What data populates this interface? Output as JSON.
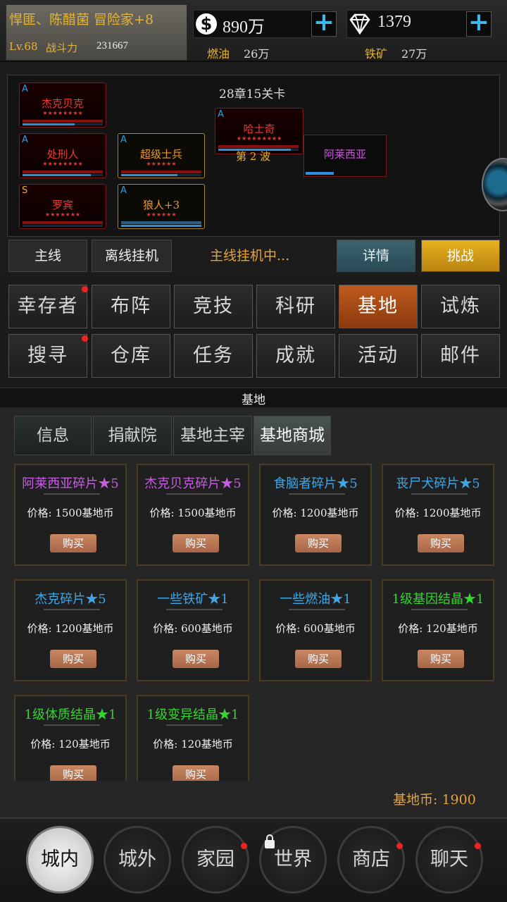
{
  "player": {
    "name": "悍匪、陈醋菌 冒险家+8",
    "level": "Lv.68",
    "power_label": "战斗力",
    "power_value": "231667"
  },
  "resources": {
    "money": "890万",
    "diamonds": "1379",
    "fuel_label": "燃油",
    "fuel_value": "26万",
    "ore_label": "铁矿",
    "ore_value": "27万",
    "money_icon": "dollar-coin-icon",
    "diamond_icon": "diamond-icon",
    "plus_symbol": "+"
  },
  "battle": {
    "stage": "28章15关卡",
    "wave": "第 2 波",
    "allies": [
      {
        "grade": "A",
        "name": "杰克贝克",
        "stars": "★★★★★★★★"
      },
      {
        "grade": "A",
        "name": "处刑人",
        "stars": "★★★★★★★★"
      },
      {
        "grade": "A",
        "name": "超级士兵",
        "stars": "★★★★★★"
      },
      {
        "grade": "S",
        "name": "罗宾",
        "stars": "★★★★★★★"
      },
      {
        "grade": "A",
        "name": "狼人+3",
        "stars": "★★★★★★"
      }
    ],
    "enemy": {
      "grade": "A",
      "name": "哈士奇",
      "stars": "★★★★★★★★★"
    },
    "boss": {
      "name": "阿莱西亚"
    }
  },
  "modes": {
    "main": "主线",
    "offline": "离线挂机",
    "status": "主线挂机中...",
    "detail": "详情",
    "challenge": "挑战"
  },
  "menu": [
    "幸存者",
    "布阵",
    "竞技",
    "科研",
    "基地",
    "试炼",
    "搜寻",
    "仓库",
    "任务",
    "成就",
    "活动",
    "邮件"
  ],
  "section_title": "基地",
  "sub_tabs": [
    "信息",
    "捐献院",
    "基地主宰",
    "基地商城"
  ],
  "shop": {
    "buy_label": "购买",
    "items": [
      {
        "name": "阿莱西亚碎片★5",
        "price": "价格: 1500基地币",
        "color": "#c75de2"
      },
      {
        "name": "杰克贝克碎片★5",
        "price": "价格: 1500基地币",
        "color": "#c75de2"
      },
      {
        "name": "食脑者碎片★5",
        "price": "价格: 1200基地币",
        "color": "#3fa7e6"
      },
      {
        "name": "丧尸犬碎片★5",
        "price": "价格: 1200基地币",
        "color": "#3fa7e6"
      },
      {
        "name": "杰克碎片★5",
        "price": "价格: 1200基地币",
        "color": "#3fa7e6"
      },
      {
        "name": "一些铁矿★1",
        "price": "价格: 600基地币",
        "color": "#3fa7e6"
      },
      {
        "name": "一些燃油★1",
        "price": "价格: 600基地币",
        "color": "#3fa7e6"
      },
      {
        "name": "1级基因结晶★1",
        "price": "价格: 120基地币",
        "color": "#33d62d"
      },
      {
        "name": "1级体质结晶★1",
        "price": "价格: 120基地币",
        "color": "#33d62d"
      },
      {
        "name": "1级变异结晶★1",
        "price": "价格: 120基地币",
        "color": "#33d62d"
      }
    ]
  },
  "base_coins": "基地币: 1900",
  "bottom_nav": [
    "城内",
    "城外",
    "家园",
    "世界",
    "商店",
    "聊天"
  ]
}
